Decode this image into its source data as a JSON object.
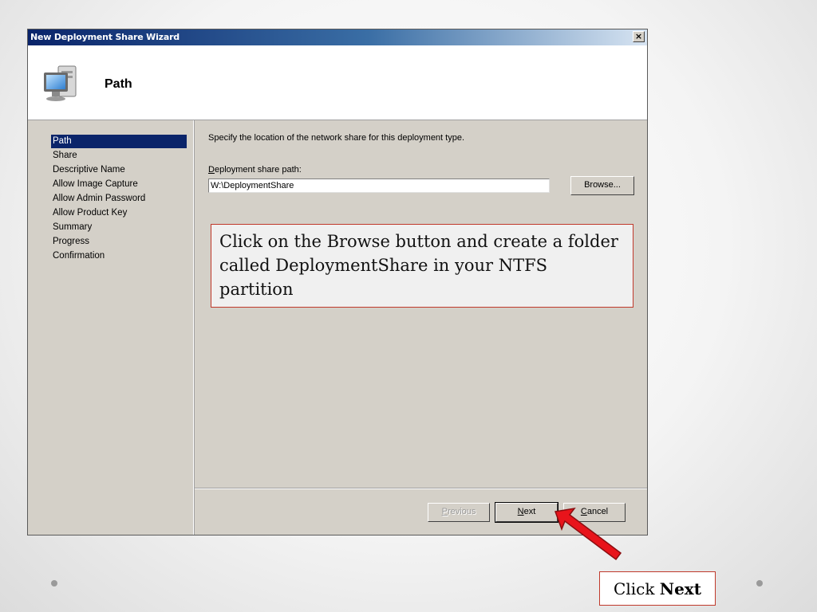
{
  "window": {
    "title": "New Deployment Share Wizard",
    "close_glyph": "×"
  },
  "header": {
    "title": "Path",
    "icon": "computer-icon"
  },
  "steps": [
    {
      "label": "Path",
      "active": true
    },
    {
      "label": "Share",
      "active": false
    },
    {
      "label": "Descriptive Name",
      "active": false
    },
    {
      "label": "Allow Image Capture",
      "active": false
    },
    {
      "label": "Allow Admin Password",
      "active": false
    },
    {
      "label": "Allow Product Key",
      "active": false
    },
    {
      "label": "Summary",
      "active": false
    },
    {
      "label": "Progress",
      "active": false
    },
    {
      "label": "Confirmation",
      "active": false
    }
  ],
  "content": {
    "instruction": "Specify the location of the network share for this deployment type.",
    "path_label": "Deployment share path:",
    "path_value": "W:\\DeploymentShare",
    "browse_label": "Browse..."
  },
  "footer": {
    "previous_label": "Previous",
    "next_label": "Next",
    "cancel_label": "Cancel"
  },
  "annotations": {
    "callout_text": "Click on the Browse button and create a folder called DeploymentShare in your NTFS partition",
    "click_prefix": "Click ",
    "click_bold": "Next",
    "accent_color": "#c0392b",
    "arrow_color": "#e8141b"
  }
}
